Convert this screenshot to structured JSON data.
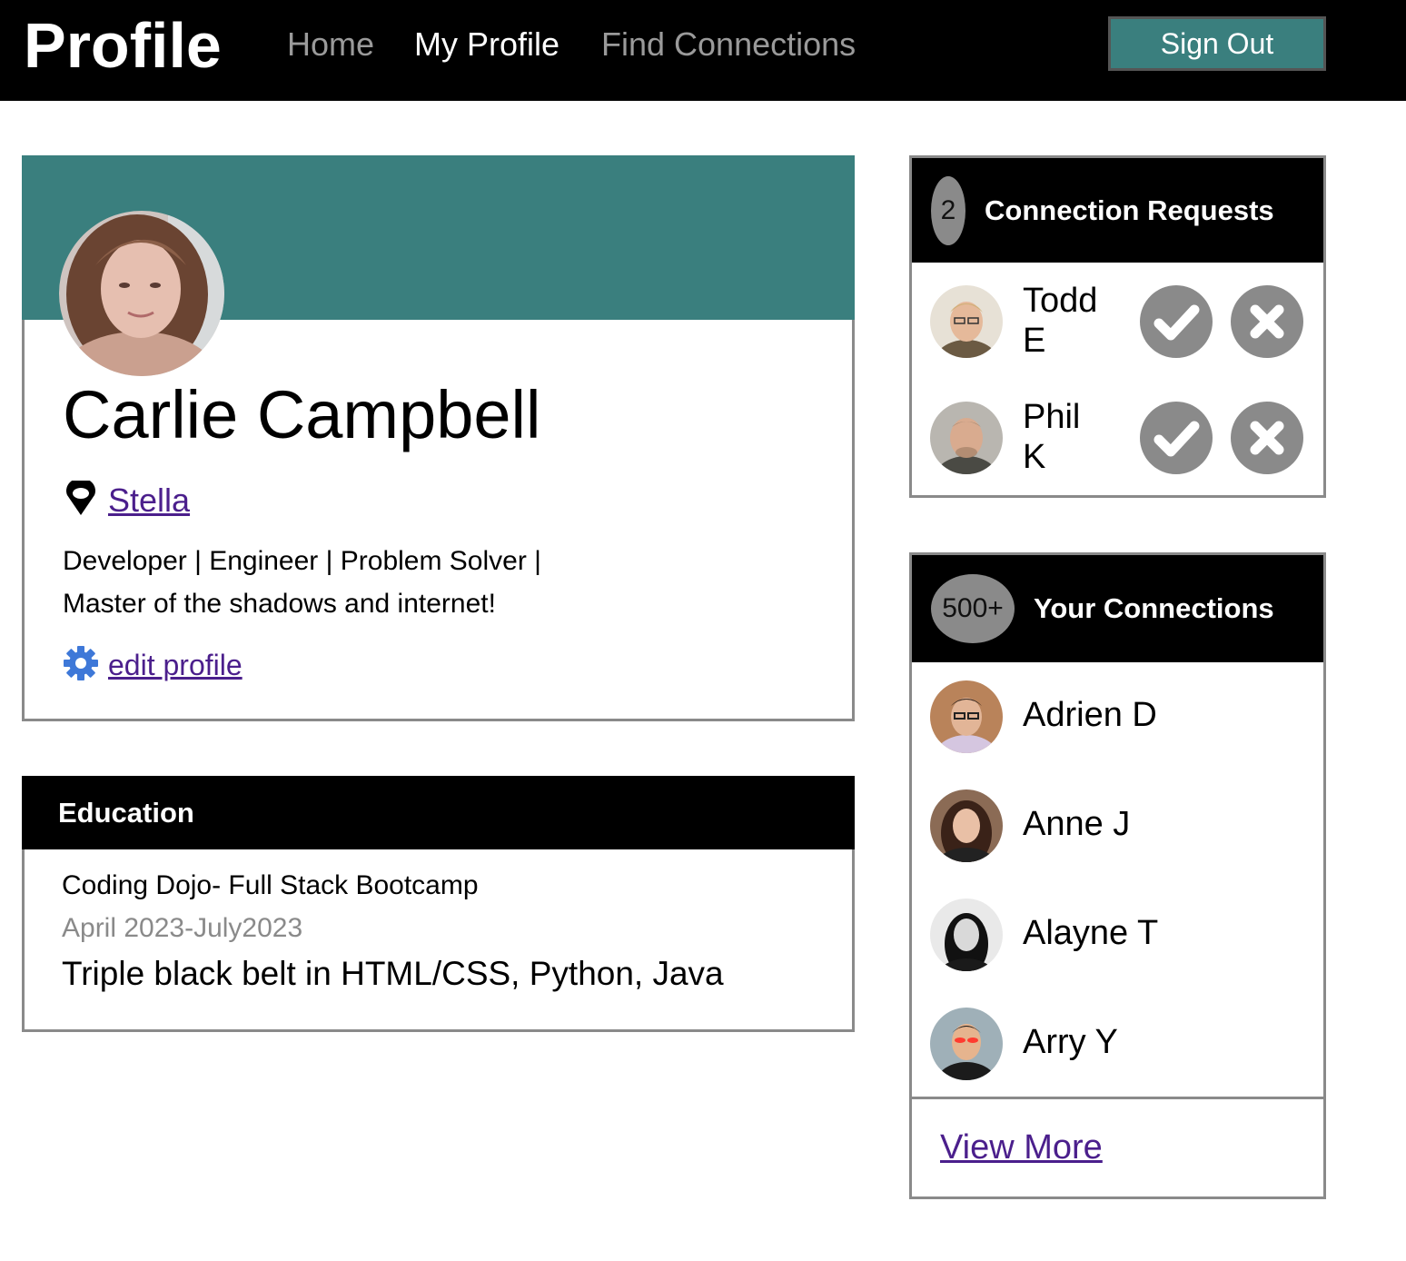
{
  "header": {
    "brand": "Profile",
    "nav": [
      {
        "label": "Home"
      },
      {
        "label": "My Profile"
      },
      {
        "label": "Find Connections"
      }
    ],
    "active_nav": "My Profile",
    "sign_out": "Sign Out"
  },
  "profile": {
    "name": "Carlie Campbell",
    "location": "Stella",
    "bio_line1": "Developer | Engineer | Problem Solver |",
    "bio_line2": "Master of the shadows and internet!",
    "edit_label": "edit profile"
  },
  "education": {
    "heading": "Education",
    "school": "Coding Dojo- Full Stack Bootcamp",
    "dates": "April 2023-July2023",
    "description": "Triple black belt in HTML/CSS, Python, Java"
  },
  "requests": {
    "count": "2",
    "heading": "Connection Requests",
    "items": [
      {
        "first": "Todd",
        "last": "E"
      },
      {
        "first": "Phil",
        "last": "K"
      }
    ]
  },
  "connections": {
    "count": "500+",
    "heading": "Your Connections",
    "items": [
      {
        "name": "Adrien D"
      },
      {
        "name": "Anne J"
      },
      {
        "name": "Alayne T"
      },
      {
        "name": "Arry Y"
      }
    ],
    "view_more": "View More"
  },
  "colors": {
    "accent_teal": "#3a7f7e",
    "link_purple": "#4b1f8c",
    "muted_gray": "#8a8a8a"
  }
}
